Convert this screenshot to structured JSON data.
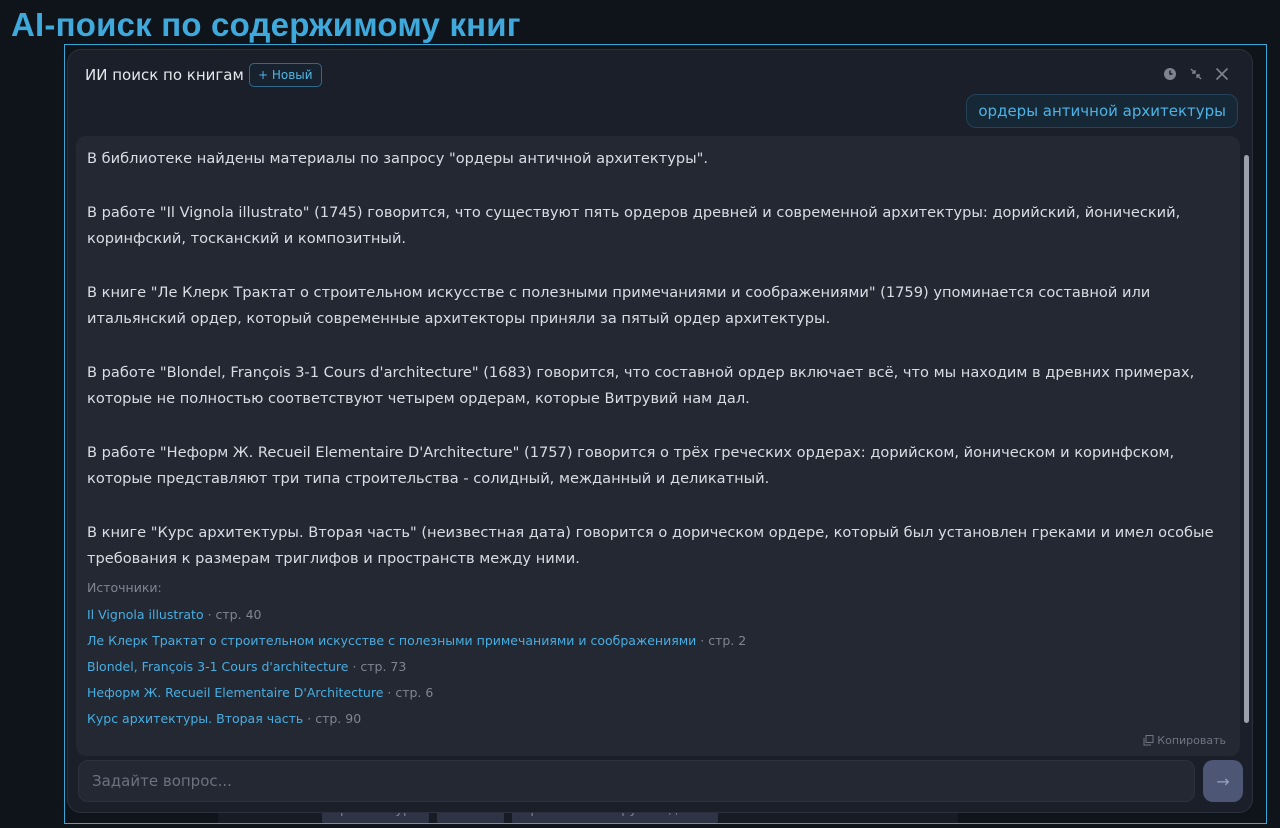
{
  "page": {
    "title": "AI-поиск по содержимому книг"
  },
  "background_tags": [
    "архитектура",
    "готика",
    "практическое руководство"
  ],
  "panel": {
    "title": "ИИ поиск по книгам",
    "new_button": "+ Новый",
    "icons": [
      "history-icon",
      "minimize-icon",
      "close-icon"
    ]
  },
  "user_message": "ордеры античной архитектуры",
  "answer": {
    "paragraphs": [
      "В библиотеке найдены материалы по запросу \"ордеры античной архитектуры\".",
      "В работе \"Il Vignola illustrato\" (1745) говорится, что существуют пять ордеров древней и современной архитектуры: дорийский, йонический, коринфский, тосканский и композитный.",
      "В книге \"Ле Клерк Трактат о строительном искусстве с полезными примечаниями и соображениями\" (1759) упоминается составной или итальянский ордер, который современные архитекторы приняли за пятый ордер архитектуры.",
      "В работе \"Blondel, François 3-1 Cours d'architecture\" (1683) говорится, что составной ордер включает всё, что мы находим в древних примерах, которые не полностью соответствуют четырем ордерам, которые Витрувий нам дал.",
      "В работе \"Неформ Ж. Recueil Elementaire D'Architecture\" (1757) говорится о трёх греческих ордерах: дорийском, йоническом и коринфском, которые представляют три типа строительства - солидный, межданный и деликатный.",
      "В книге \"Курс архитектуры. Вторая часть\" (неизвестная дата) говорится о дорическом ордере, который был установлен греками и имел особые требования к размерам триглифов и пространств между ними."
    ],
    "sources_label": "Источники:",
    "sources": [
      {
        "title": "Il Vignola illustrato",
        "page": " · стр. 40"
      },
      {
        "title": "Ле Клерк Трактат о строительном искусстве с полезными примечаниями и соображениями",
        "page": " · стр. 2"
      },
      {
        "title": "Blondel, François 3-1 Cours d'architecture",
        "page": " · стр. 73"
      },
      {
        "title": "Неформ Ж. Recueil Elementaire D'Architecture",
        "page": " · стр. 6"
      },
      {
        "title": "Курс архитектуры. Вторая часть",
        "page": " · стр. 90"
      }
    ],
    "copy_label": "Копировать"
  },
  "input": {
    "placeholder": "Задайте вопрос...",
    "value": ""
  },
  "send_button": "→",
  "colors": {
    "accent": "#3fa9dc",
    "panel_bg": "#1a1f29",
    "answer_bg": "#232833",
    "send_bg": "#4d5675"
  }
}
